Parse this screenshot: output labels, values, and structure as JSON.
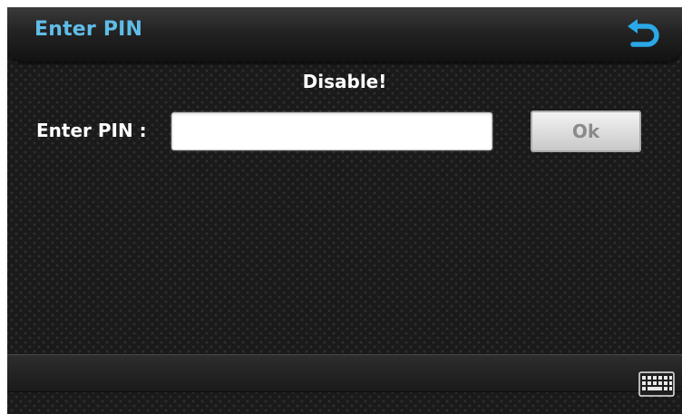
{
  "header": {
    "title": "Enter PIN",
    "back_icon": "back-arrow-icon"
  },
  "status": {
    "message": "Disable!"
  },
  "form": {
    "pin_label": "Enter PIN :",
    "pin_value": "",
    "pin_placeholder": "",
    "ok_label": "Ok"
  },
  "footer": {
    "keyboard_icon": "keyboard-icon"
  },
  "colors": {
    "title": "#5fbde8",
    "accent_icon": "#2aa8e8",
    "background": "#1a1a1a",
    "ok_text_disabled": "#8a8a8a"
  }
}
